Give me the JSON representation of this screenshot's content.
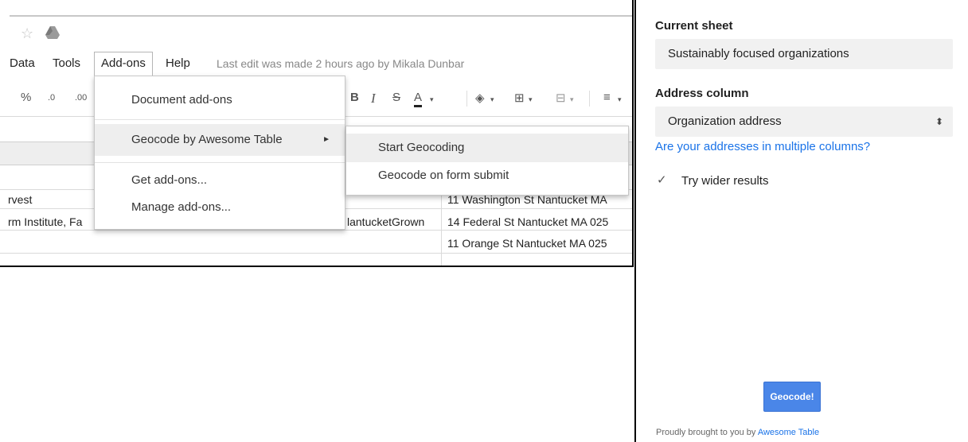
{
  "menubar": {
    "items": [
      "Data",
      "Tools",
      "Add-ons",
      "Help"
    ],
    "last_edit": "Last edit was made 2 hours ago by Mikala Dunbar"
  },
  "toolbar": {
    "percent": "%",
    "decimal_decrease": ".0",
    "decimal_increase": ".00",
    "bold": "B",
    "italic": "I",
    "strikethrough": "S",
    "text_color": "A"
  },
  "addons_menu": {
    "items": [
      "Document add-ons",
      "Geocode by Awesome Table",
      "Get add-ons...",
      "Manage add-ons..."
    ],
    "arrow": "►"
  },
  "geocode_submenu": {
    "items": [
      "Start Geocoding",
      "Geocode on form submit"
    ]
  },
  "grid": {
    "rows": [
      {
        "a": "rvest",
        "b": "",
        "c": "11 Washington St Nantucket MA"
      },
      {
        "a": "rm Institute, Fa",
        "b": "lantucketGrown",
        "c": "14 Federal St Nantucket MA 025"
      },
      {
        "a": "",
        "b": "",
        "c": "11 Orange St Nantucket MA 025"
      }
    ]
  },
  "sidebar": {
    "current_sheet_label": "Current sheet",
    "current_sheet_value": "Sustainably focused organizations",
    "address_column_label": "Address column",
    "address_column_value": "Organization address",
    "multi_columns_link": "Are your addresses in multiple columns?",
    "try_wider_label": "Try wider results",
    "try_wider_checked": true,
    "geocode_button": "Geocode!",
    "footer_text": "Proudly brought to you by",
    "footer_link": "Awesome Table"
  },
  "colors": {
    "accent": "#4a86e8",
    "link": "#1a73e8",
    "highlight": "#eeeeee"
  }
}
